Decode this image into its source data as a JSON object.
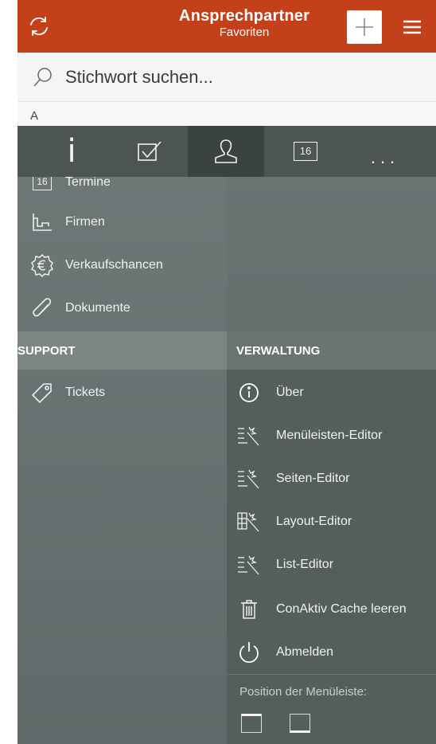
{
  "header": {
    "title": "Ansprechpartner",
    "subtitle": "Favoriten",
    "accent": "#c4401b"
  },
  "search": {
    "placeholder": "Stichwort suchen..."
  },
  "list": {
    "section_letter": "A"
  },
  "tabbar": {
    "items": [
      {
        "icon": "info-icon"
      },
      {
        "icon": "checkbox-icon"
      },
      {
        "icon": "contact-icon",
        "active": true
      },
      {
        "icon": "calendar-icon",
        "label": "16"
      },
      {
        "icon": "more-icon",
        "label": "..."
      }
    ]
  },
  "left_menu": {
    "items": [
      {
        "label": "Termine",
        "icon": "calendar-icon",
        "icon_text": "16"
      },
      {
        "label": "Firmen",
        "icon": "chart-icon"
      },
      {
        "label": "Verkaufschancen",
        "icon": "euro-icon"
      },
      {
        "label": "Dokumente",
        "icon": "paperclip-icon"
      }
    ],
    "support_header": "SUPPORT",
    "support_items": [
      {
        "label": "Tickets",
        "icon": "tag-icon"
      }
    ]
  },
  "right_menu": {
    "header": "VERWALTUNG",
    "items": [
      {
        "label": "Über",
        "icon": "info-circle-icon"
      },
      {
        "label": "Menüleisten-Editor",
        "icon": "list-magic-icon"
      },
      {
        "label": "Seiten-Editor",
        "icon": "list-magic-icon"
      },
      {
        "label": "Layout-Editor",
        "icon": "grid-magic-icon"
      },
      {
        "label": "List-Editor",
        "icon": "list-magic-icon"
      },
      {
        "label": "ConAktiv Cache leeren",
        "icon": "trash-icon"
      },
      {
        "label": "Abmelden",
        "icon": "power-icon"
      }
    ],
    "position_label": "Position der Menüleiste:"
  }
}
